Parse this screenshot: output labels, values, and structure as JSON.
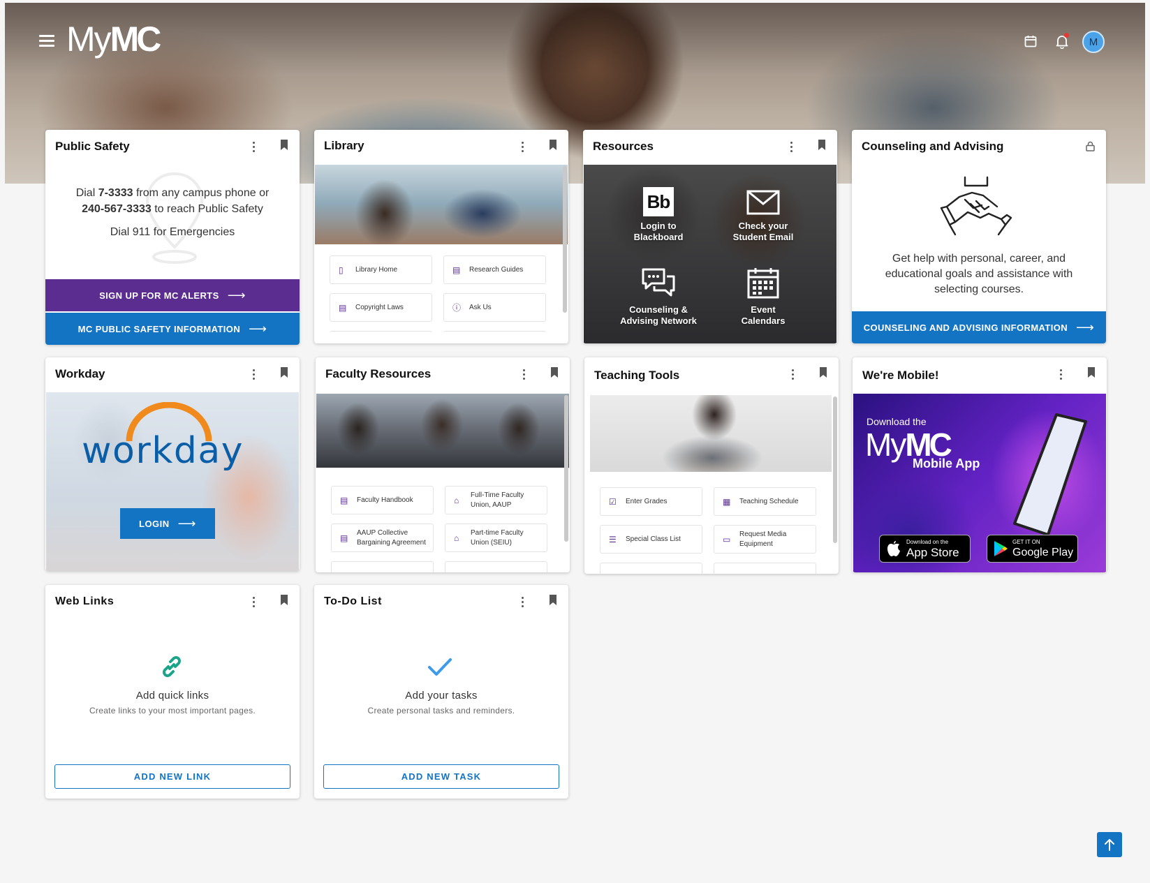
{
  "header": {
    "logo_my": "My",
    "logo_mc": "MC",
    "avatar_initial": "M"
  },
  "cards": {
    "public_safety": {
      "title": "Public Safety",
      "line1_pre": "Dial ",
      "line1_bold": "7-3333",
      "line1_post": " from any campus phone or",
      "line2_bold": "240-567-3333",
      "line2_post": " to reach Public Safety",
      "line3": "Dial 911 for Emergencies",
      "alerts_btn": "SIGN UP FOR MC ALERTS",
      "info_btn": "MC PUBLIC SAFETY INFORMATION"
    },
    "library": {
      "title": "Library",
      "links": [
        "Library Home",
        "Research Guides",
        "Copyright Laws",
        "Ask Us"
      ]
    },
    "resources": {
      "title": "Resources",
      "items": [
        {
          "icon": "Bb",
          "l1": "Login to",
          "l2": "Blackboard"
        },
        {
          "l1": "Check your",
          "l2": "Student Email"
        },
        {
          "l1": "Counseling &",
          "l2": "Advising Network"
        },
        {
          "l1": "Event",
          "l2": "Calendars"
        }
      ]
    },
    "counseling": {
      "title": "Counseling and Advising",
      "text1": "Get help with personal, career, and",
      "text2": "educational goals and assistance with",
      "text3": "selecting courses.",
      "btn": "COUNSELING AND ADVISING INFORMATION"
    },
    "workday": {
      "title": "Workday",
      "logo": "workday",
      "btn": "LOGIN"
    },
    "faculty": {
      "title": "Faculty Resources",
      "links": [
        {
          "l1": "Faculty Handbook",
          "l2": ""
        },
        {
          "l1": "Full-Time Faculty",
          "l2": "Union, AAUP"
        },
        {
          "l1": "AAUP Collective",
          "l2": "Bargaining Agreement"
        },
        {
          "l1": "Part-time Faculty",
          "l2": "Union (SEIU)"
        }
      ]
    },
    "teaching": {
      "title": "Teaching Tools",
      "links": [
        {
          "l1": "Enter Grades",
          "l2": ""
        },
        {
          "l1": "Teaching Schedule",
          "l2": ""
        },
        {
          "l1": "Special Class List",
          "l2": ""
        },
        {
          "l1": "Request Media",
          "l2": "Equipment"
        }
      ]
    },
    "mobile": {
      "title": "We're Mobile!",
      "download": "Download the",
      "logo_my": "My",
      "logo_mc": "MC",
      "app": "Mobile App",
      "apple_small": "Download on the",
      "apple_big": "App Store",
      "google_small": "GET IT ON",
      "google_big": "Google Play"
    },
    "weblinks": {
      "title": "Web Links",
      "heading": "Add quick links",
      "sub": "Create links to your most important pages.",
      "btn": "ADD NEW LINK"
    },
    "todo": {
      "title": "To-Do List",
      "heading": "Add your tasks",
      "sub": "Create personal tasks and reminders.",
      "btn": "ADD NEW TASK"
    }
  },
  "colors": {
    "purple": "#5b2d90",
    "blue": "#1474c4",
    "page_bg": "#f5f5f5"
  }
}
